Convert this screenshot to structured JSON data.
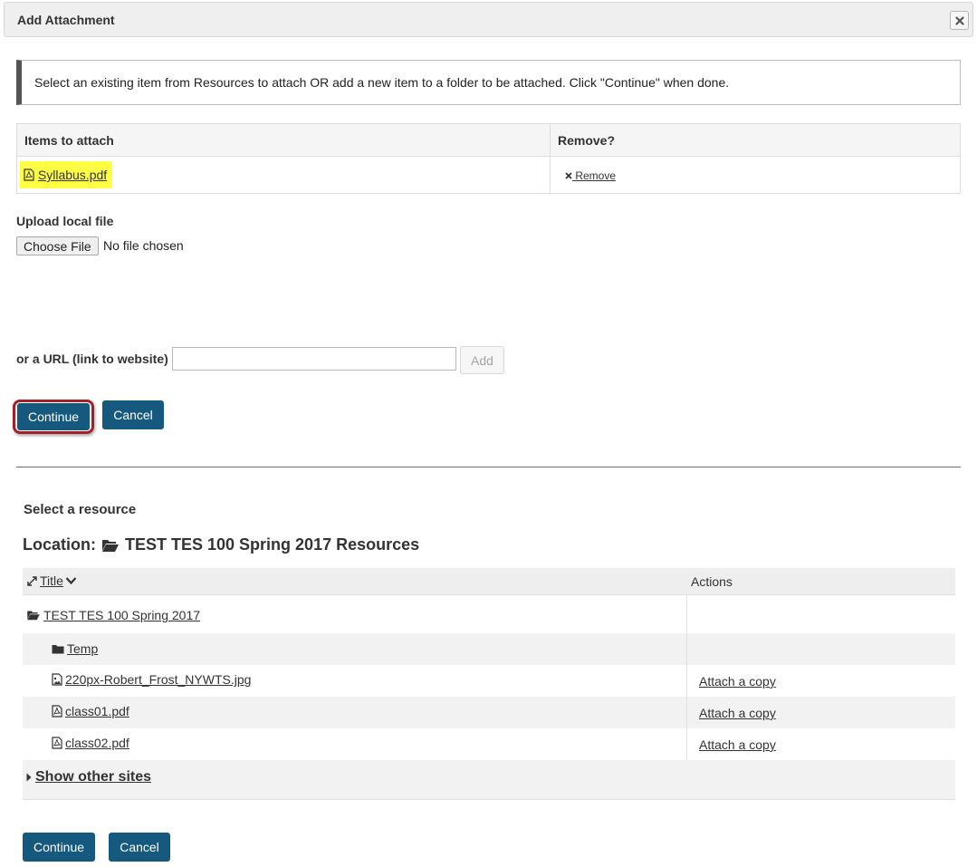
{
  "dialog": {
    "title": "Add Attachment",
    "instructions": "Select an existing item from Resources to attach OR add a new item to a folder to be attached. Click \"Continue\" when done."
  },
  "attach_table": {
    "headers": [
      "Items to attach",
      "Remove?"
    ],
    "items": [
      {
        "name": "Syllabus.pdf",
        "remove_label": "Remove"
      }
    ]
  },
  "upload": {
    "label": "Upload local file",
    "button": "Choose File",
    "status": "No file chosen"
  },
  "url": {
    "label": "or a URL (link to website)",
    "value": "",
    "add_button": "Add"
  },
  "buttons": {
    "continue": "Continue",
    "cancel": "Cancel"
  },
  "resources": {
    "heading": "Select a resource",
    "location_label": "Location:",
    "location_name": "TEST TES 100 Spring 2017 Resources",
    "columns": {
      "title": "Title",
      "actions": "Actions"
    },
    "rows": [
      {
        "name": "TEST TES 100 Spring 2017",
        "icon": "folder-open-icon",
        "action": ""
      },
      {
        "name": "Temp",
        "icon": "folder-icon",
        "action": ""
      },
      {
        "name": "220px-Robert_Frost_NYWTS.jpg",
        "icon": "image-file-icon",
        "action": "Attach a copy"
      },
      {
        "name": "class01.pdf",
        "icon": "pdf-file-icon",
        "action": "Attach a copy"
      },
      {
        "name": "class02.pdf",
        "icon": "pdf-file-icon",
        "action": "Attach a copy"
      }
    ],
    "other_sites": "Show other sites"
  },
  "colors": {
    "primary": "#15597e",
    "highlight": "#ffff44",
    "focus_ring": "#a31f2a"
  }
}
